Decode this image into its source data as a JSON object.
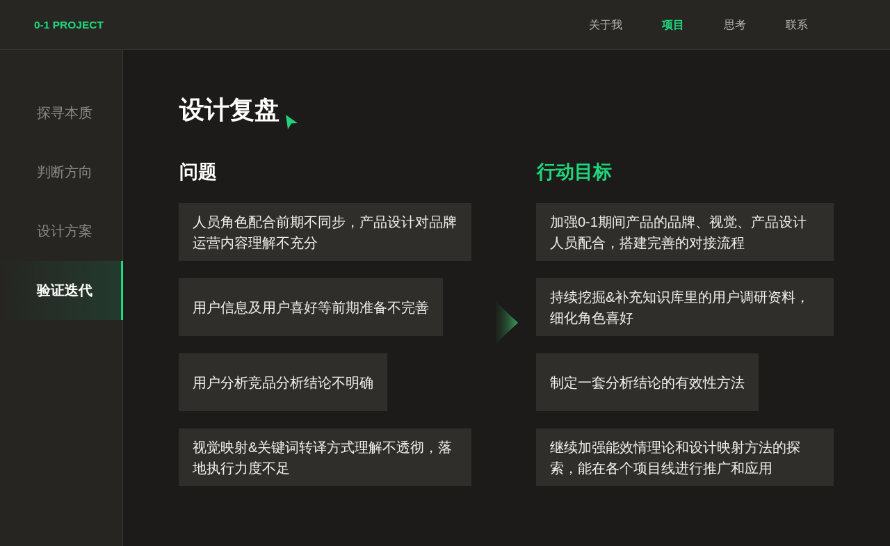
{
  "header": {
    "logo": "0-1 PROJECT",
    "nav": [
      {
        "label": "关于我",
        "selected": false
      },
      {
        "label": "项目",
        "selected": true
      },
      {
        "label": "思考",
        "selected": false
      },
      {
        "label": "联系",
        "selected": false
      }
    ]
  },
  "sidebar": {
    "items": [
      {
        "label": "探寻本质",
        "selected": false
      },
      {
        "label": "判断方向",
        "selected": false
      },
      {
        "label": "设计方案",
        "selected": false
      },
      {
        "label": "验证迭代",
        "selected": true
      }
    ]
  },
  "main": {
    "title": "设计复盘",
    "columns": [
      {
        "heading": "问题",
        "highlighted": false,
        "cards": [
          "人员角色配合前期不同步，产品设计对品牌运营内容理解不充分",
          "用户信息及用户喜好等前期准备不完善",
          "用户分析竞品分析结论不明确",
          "视觉映射&关键词转译方式理解不透彻，落地执行力度不足"
        ]
      },
      {
        "heading": "行动目标",
        "highlighted": true,
        "cards": [
          "加强0-1期间产品的品牌、视觉、产品设计人员配合，搭建完善的对接流程",
          "持续挖掘&补充知识库里的用户调研资料，细化角色喜好",
          "制定一套分析结论的有效性方法",
          "继续加强能效情理论和设计映射方法的探索，能在各个项目线进行推广和应用"
        ]
      }
    ]
  }
}
